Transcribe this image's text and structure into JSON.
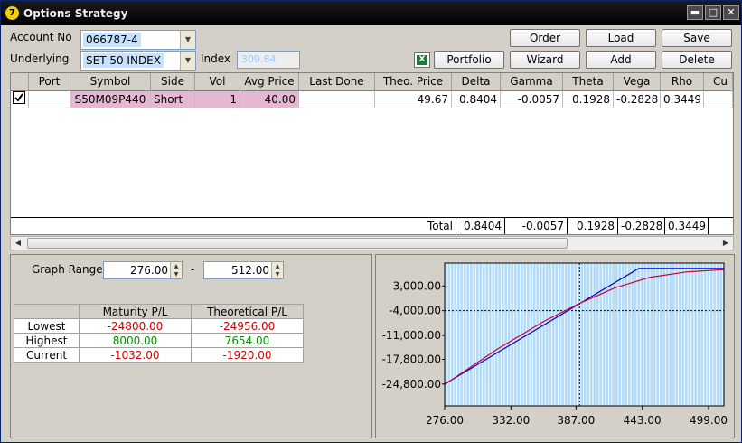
{
  "window": {
    "title": "Options Strategy",
    "app_logo": "7"
  },
  "form": {
    "account_label": "Account No",
    "account_value": "066787-4",
    "underlying_label": "Underlying",
    "underlying_value": "SET 50 INDEX",
    "index_label": "Index",
    "index_value": "309.84"
  },
  "toolbar": {
    "order": "Order",
    "load": "Load",
    "save": "Save",
    "portfolio": "Portfolio",
    "wizard": "Wizard",
    "add": "Add",
    "delete": "Delete",
    "excel_icon": "excel-icon"
  },
  "table": {
    "headers": [
      "Port",
      "Symbol",
      "Side",
      "Vol",
      "Avg Price",
      "Last Done",
      "Theo. Price",
      "Delta",
      "Gamma",
      "Theta",
      "Vega",
      "Rho",
      "Cu"
    ],
    "row": {
      "port": "",
      "symbol": "S50M09P440",
      "side": "Short",
      "vol": "1",
      "avg_price": "40.00",
      "last_done": "",
      "theo_price": "49.67",
      "delta": "0.8404",
      "gamma": "-0.0057",
      "theta": "0.1928",
      "vega": "-0.2828",
      "rho": "0.3449"
    },
    "total": {
      "label": "Total",
      "delta": "0.8404",
      "gamma": "-0.0057",
      "theta": "0.1928",
      "vega": "-0.2828",
      "rho": "0.3449"
    }
  },
  "graph_range": {
    "label": "Graph Range",
    "from": "276.00",
    "sep": "-",
    "to": "512.00"
  },
  "pl": {
    "headers": [
      "",
      "Maturity P/L",
      "Theoretical P/L"
    ],
    "rows": [
      {
        "label": "Lowest",
        "maturity": "-24800.00",
        "theoretical": "-24956.00"
      },
      {
        "label": "Highest",
        "maturity": "8000.00",
        "theoretical": "7654.00"
      },
      {
        "label": "Current",
        "maturity": "-1032.00",
        "theoretical": "-1920.00"
      }
    ]
  },
  "chart_data": {
    "type": "line",
    "x_ticks": [
      "276.00",
      "332.00",
      "387.00",
      "443.00",
      "499.00"
    ],
    "y_ticks": [
      "3,000.00",
      "-4,000.00",
      "-11,000.00",
      "-17,800.00",
      "-24,800.00"
    ],
    "xlim": [
      276,
      512
    ],
    "ylim": [
      -31000,
      9500
    ],
    "current_x": 390,
    "ref_y": -4000,
    "series": [
      {
        "color": "#0000cc",
        "x": [
          276,
          440,
          512
        ],
        "y": [
          -24800,
          8000,
          8000
        ]
      },
      {
        "color": "#cc0033",
        "x": [
          276,
          320,
          360,
          390,
          420,
          450,
          480,
          512
        ],
        "y": [
          -24956,
          -15000,
          -7000,
          -1920,
          2500,
          5500,
          7000,
          7654
        ]
      }
    ],
    "colors": {
      "background": "#b4dcf8",
      "grid": "#ffffff",
      "ref_line": "#000000"
    }
  }
}
